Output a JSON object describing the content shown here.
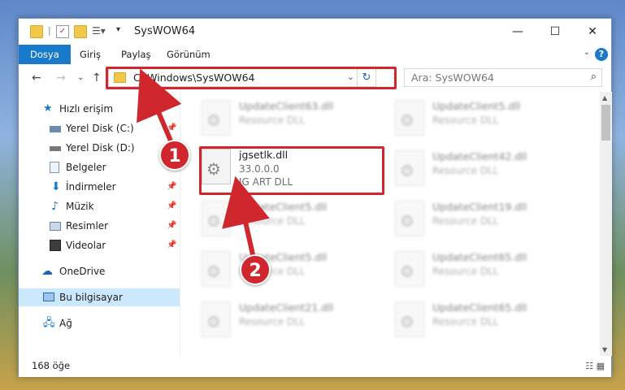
{
  "window": {
    "title": "SysWOW64"
  },
  "ribbon": {
    "tabs": [
      "Dosya",
      "Giriş",
      "Paylaş",
      "Görünüm"
    ]
  },
  "nav": {
    "address": "C:\\Windows\\SysWOW64",
    "search_placeholder": "Ara: SysWOW64"
  },
  "sidebar": {
    "items": [
      {
        "label": "Hızlı erişim",
        "icon": "star-icon"
      },
      {
        "label": "Yerel Disk (C:)",
        "icon": "drive-icon",
        "pinned": true
      },
      {
        "label": "Yerel Disk (D:)",
        "icon": "drive-icon",
        "pinned": true
      },
      {
        "label": "Belgeler",
        "icon": "document-icon",
        "pinned": true
      },
      {
        "label": "İndirmeler",
        "icon": "download-icon",
        "pinned": true
      },
      {
        "label": "Müzik",
        "icon": "music-icon",
        "pinned": true
      },
      {
        "label": "Resimler",
        "icon": "pictures-icon",
        "pinned": true
      },
      {
        "label": "Videolar",
        "icon": "video-icon",
        "pinned": true
      },
      {
        "label": "OneDrive",
        "icon": "cloud-icon"
      },
      {
        "label": "Bu bilgisayar",
        "icon": "computer-icon"
      },
      {
        "label": "Ağ",
        "icon": "network-icon"
      }
    ]
  },
  "files": {
    "highlighted": {
      "name": "jgsetlk.dll",
      "version": "33.0.0.0",
      "description": "JG ART DLL"
    },
    "left": [
      {
        "name": "UpdateClient63.dll",
        "desc": "Resource DLL"
      },
      {
        "name": "UpdateClient5.dll",
        "desc": "Resource DLL"
      },
      {
        "name": "UpdateClient5.dll",
        "desc": "Resource DLL"
      },
      {
        "name": "UpdateClient21.dll",
        "desc": "Resource DLL"
      }
    ],
    "right": [
      {
        "name": "UpdateClient5.dll",
        "desc": "Resource DLL"
      },
      {
        "name": "UpdateClient42.dll",
        "desc": "Resource DLL"
      },
      {
        "name": "UpdateClient19.dll",
        "desc": "Resource DLL"
      },
      {
        "name": "UpdateClient65.dll",
        "desc": "Resource DLL"
      },
      {
        "name": "UpdateClient65.dll",
        "desc": "Resource DLL"
      }
    ]
  },
  "status": {
    "count": "168 öğe"
  },
  "annotations": {
    "step1": "1",
    "step2": "2",
    "color": "#d0262d"
  }
}
